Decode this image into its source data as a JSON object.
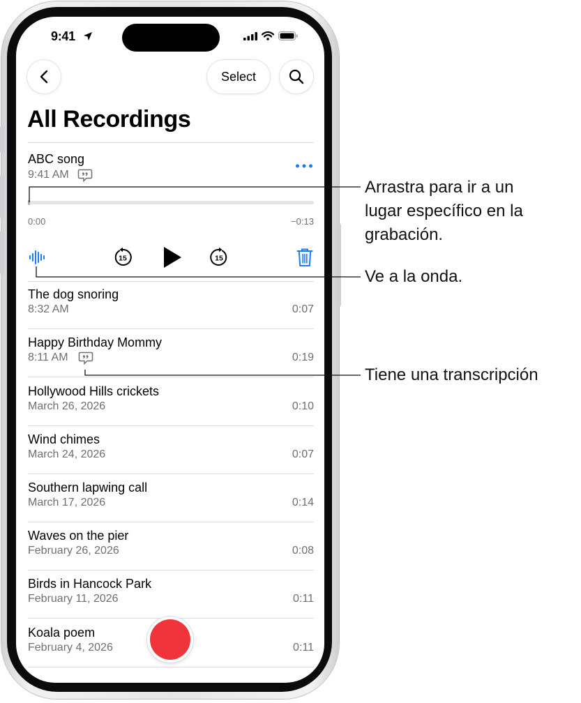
{
  "status_bar": {
    "time": "9:41"
  },
  "nav": {
    "select_label": "Select"
  },
  "page_title": "All Recordings",
  "expanded": {
    "name": "ABC song",
    "date": "9:41 AM",
    "time_start": "0:00",
    "time_end": "−0:13",
    "skip_back_label": "15",
    "skip_forward_label": "15"
  },
  "recordings": [
    {
      "name": "The dog snoring",
      "date": "8:32 AM",
      "duration": "0:07",
      "has_transcript": false
    },
    {
      "name": "Happy Birthday Mommy",
      "date": "8:11 AM",
      "duration": "0:19",
      "has_transcript": true
    },
    {
      "name": "Hollywood Hills crickets",
      "date": "March 26, 2026",
      "duration": "0:10",
      "has_transcript": false
    },
    {
      "name": "Wind chimes",
      "date": "March 24, 2026",
      "duration": "0:07",
      "has_transcript": false
    },
    {
      "name": "Southern lapwing call",
      "date": "March 17, 2026",
      "duration": "0:14",
      "has_transcript": false
    },
    {
      "name": "Waves on the pier",
      "date": "February 26, 2026",
      "duration": "0:08",
      "has_transcript": false
    },
    {
      "name": "Birds in Hancock Park",
      "date": "February 11, 2026",
      "duration": "0:11",
      "has_transcript": false
    },
    {
      "name": "Koala poem",
      "date": "February 4, 2026",
      "duration": "0:11",
      "has_transcript": false
    }
  ],
  "callouts": {
    "scrub_line1": "Arrastra para ir a un",
    "scrub_line2": "lugar específico en la",
    "scrub_line3": "grabación.",
    "waveform": "Ve a la onda.",
    "transcript": "Tiene una transcripción"
  },
  "colors": {
    "accent": "#1a7cf5",
    "record": "#f0343c",
    "secondary_text": "#6e6e73"
  },
  "icons": [
    "back-chevron-icon",
    "search-icon",
    "more-icon",
    "waveform-icon",
    "skip-back-15-icon",
    "play-icon",
    "skip-forward-15-icon",
    "trash-icon",
    "transcript-quote-icon",
    "record-icon"
  ]
}
